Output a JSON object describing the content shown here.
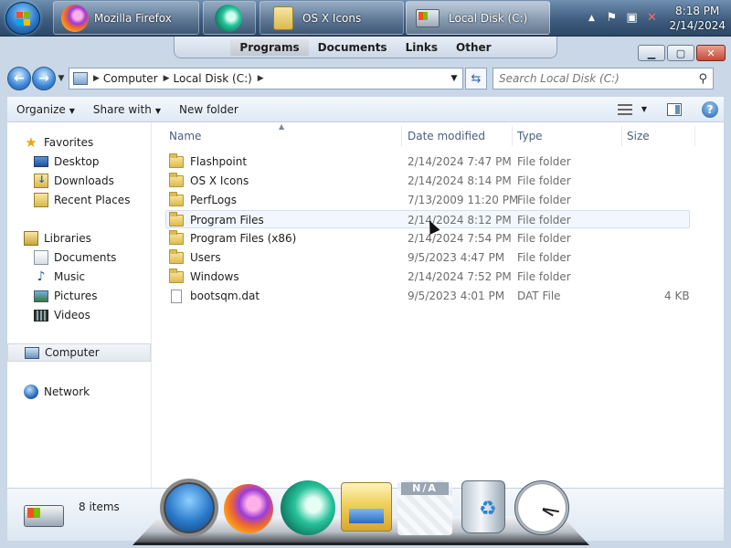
{
  "taskbar": {
    "buttons": [
      {
        "label": "Mozilla Firefox",
        "icon": "firefox-icon"
      },
      {
        "label": "",
        "icon": "app-icon"
      },
      {
        "label": "OS X Icons",
        "icon": "folder-icon"
      },
      {
        "label": "Local Disk (C:)",
        "icon": "drive-icon"
      }
    ],
    "clock": {
      "time": "8:18 PM",
      "date": "2/14/2024"
    }
  },
  "doc_tabs": [
    "Programs",
    "Documents",
    "Links",
    "Other"
  ],
  "address": {
    "crumbs": [
      "Computer",
      "Local Disk (C:)"
    ],
    "search_placeholder": "Search Local Disk (C:)"
  },
  "command_bar": {
    "organize": "Organize",
    "share_with": "Share with",
    "new_folder": "New folder"
  },
  "nav": {
    "favorites": "Favorites",
    "fav_items": [
      "Desktop",
      "Downloads",
      "Recent Places"
    ],
    "libraries": "Libraries",
    "lib_items": [
      "Documents",
      "Music",
      "Pictures",
      "Videos"
    ],
    "computer": "Computer",
    "network": "Network"
  },
  "columns": [
    "Name",
    "Date modified",
    "Type",
    "Size"
  ],
  "files": [
    {
      "name": "Flashpoint",
      "date": "2/14/2024 7:47 PM",
      "type": "File folder",
      "size": ""
    },
    {
      "name": "OS X Icons",
      "date": "2/14/2024 8:14 PM",
      "type": "File folder",
      "size": ""
    },
    {
      "name": "PerfLogs",
      "date": "7/13/2009 11:20 PM",
      "type": "File folder",
      "size": ""
    },
    {
      "name": "Program Files",
      "date": "2/14/2024 8:12 PM",
      "type": "File folder",
      "size": ""
    },
    {
      "name": "Program Files (x86)",
      "date": "2/14/2024 7:54 PM",
      "type": "File folder",
      "size": ""
    },
    {
      "name": "Users",
      "date": "9/5/2023 4:47 PM",
      "type": "File folder",
      "size": ""
    },
    {
      "name": "Windows",
      "date": "2/14/2024 7:52 PM",
      "type": "File folder",
      "size": ""
    },
    {
      "name": "bootsqm.dat",
      "date": "9/5/2023 4:01 PM",
      "type": "DAT File",
      "size": "4 KB"
    }
  ],
  "status": {
    "count": "8 items"
  },
  "dock": {
    "items": [
      "windows-icon",
      "firefox-icon",
      "app-icon",
      "folder-icon",
      "na-icon",
      "recycle-bin-icon",
      "clock-icon"
    ],
    "na_label": "N/A"
  }
}
